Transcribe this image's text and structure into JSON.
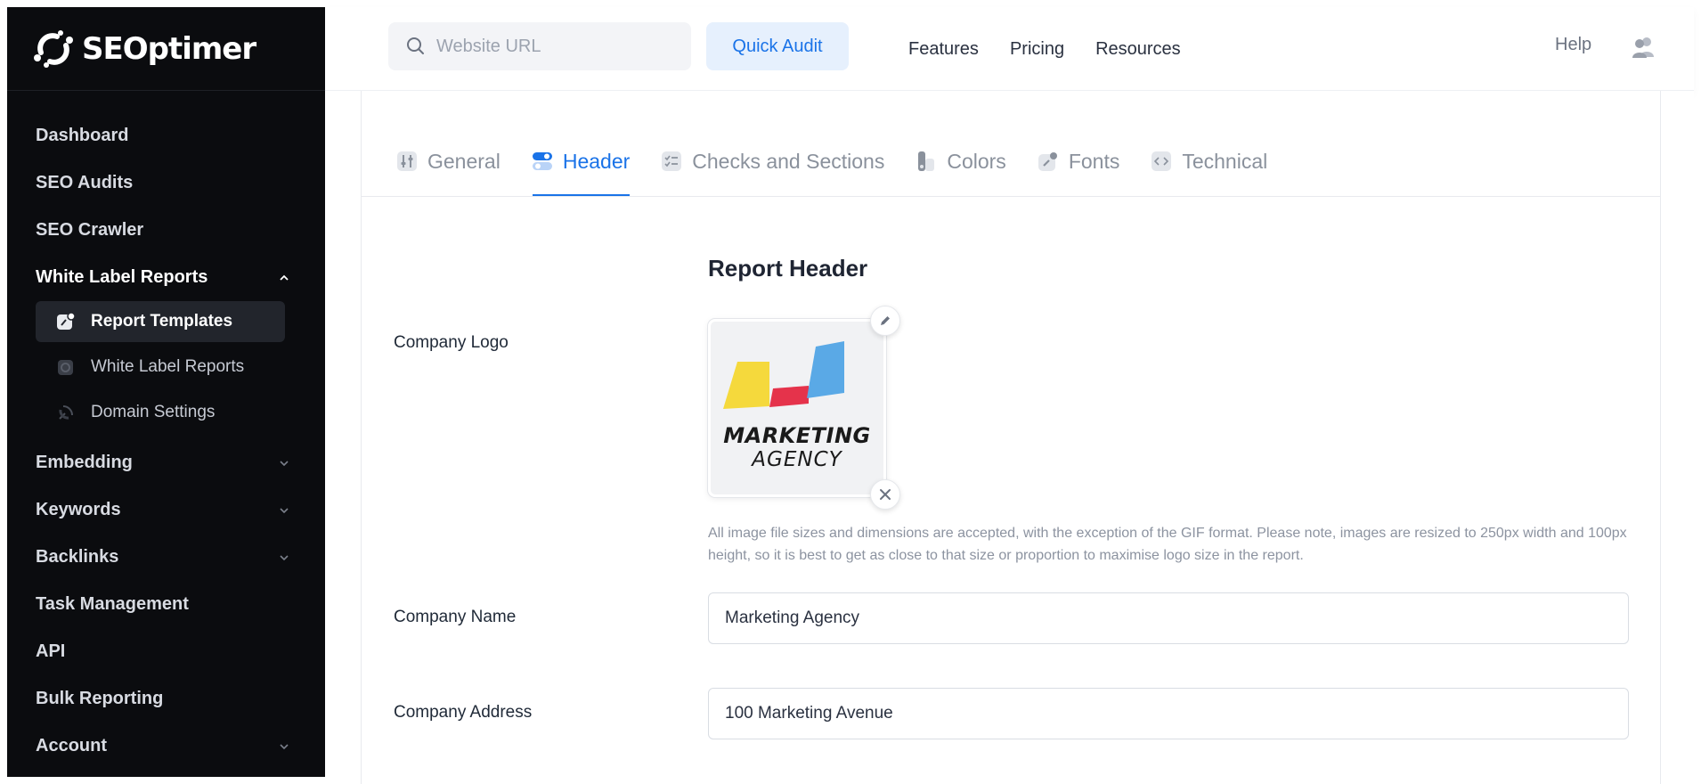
{
  "brand": {
    "name": "SEOptimer"
  },
  "sidebar": {
    "items": [
      {
        "label": "Dashboard"
      },
      {
        "label": "SEO Audits"
      },
      {
        "label": "SEO Crawler"
      },
      {
        "label": "White Label Reports",
        "expanded": true
      },
      {
        "label": "Embedding"
      },
      {
        "label": "Keywords"
      },
      {
        "label": "Backlinks"
      },
      {
        "label": "Task Management"
      },
      {
        "label": "API"
      },
      {
        "label": "Bulk Reporting"
      },
      {
        "label": "Account"
      }
    ],
    "subitems": [
      {
        "label": "Report Templates",
        "icon": "brush-icon",
        "active": true
      },
      {
        "label": "White Label Reports",
        "icon": "report-icon"
      },
      {
        "label": "Domain Settings",
        "icon": "satellite-icon"
      }
    ]
  },
  "topbar": {
    "search_placeholder": "Website URL",
    "quick_audit_label": "Quick Audit",
    "links": [
      "Features",
      "Pricing",
      "Resources"
    ],
    "help_label": "Help"
  },
  "tabs": [
    {
      "label": "General",
      "icon": "sliders-icon"
    },
    {
      "label": "Header",
      "icon": "toggle-icon",
      "active": true
    },
    {
      "label": "Checks and Sections",
      "icon": "checklist-icon"
    },
    {
      "label": "Colors",
      "icon": "palette-icon"
    },
    {
      "label": "Fonts",
      "icon": "brush-icon"
    },
    {
      "label": "Technical",
      "icon": "code-icon"
    }
  ],
  "form": {
    "section_title": "Report Header",
    "logo_label": "Company Logo",
    "logo_text_line1": "MARKETING",
    "logo_text_line2": "AGENCY",
    "logo_hint": "All image file sizes and dimensions are accepted, with the exception of the GIF format. Please note, images are resized to 250px width and 100px height, so it is best to get as close to that size or proportion to maximise logo size in the report.",
    "company_name_label": "Company Name",
    "company_name_value": "Marketing Agency",
    "company_address_label": "Company Address",
    "company_address_value": "100 Marketing Avenue"
  },
  "colors": {
    "accent": "#1a73e8",
    "sidebar_bg": "#0b0c0f",
    "logo_yellow": "#f5d93c",
    "logo_red": "#e5334b",
    "logo_blue": "#5aa9e6"
  }
}
